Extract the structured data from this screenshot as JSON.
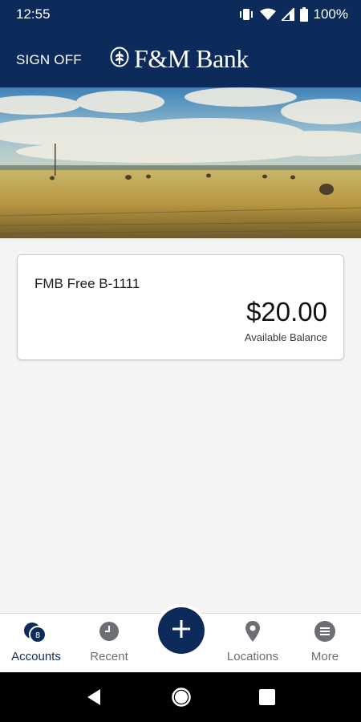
{
  "status_bar": {
    "time": "12:55",
    "battery": "100%"
  },
  "header": {
    "sign_off_label": "SIGN OFF",
    "brand_name": "F&M Bank"
  },
  "account": {
    "name": "FMB Free B-1111",
    "balance": "$20.00",
    "balance_label": "Available Balance"
  },
  "bottom_nav": {
    "items": [
      {
        "label": "Accounts",
        "icon": "accounts-icon",
        "badge": "8",
        "active": true
      },
      {
        "label": "Recent",
        "icon": "clock-icon"
      },
      {
        "label": "Locations",
        "icon": "location-pin-icon"
      },
      {
        "label": "More",
        "icon": "menu-icon"
      }
    ],
    "fab_icon": "plus-icon"
  },
  "colors": {
    "brand_navy": "#0c2b5a",
    "nav_inactive": "#6b6e73",
    "background": "#f4f4f5"
  }
}
